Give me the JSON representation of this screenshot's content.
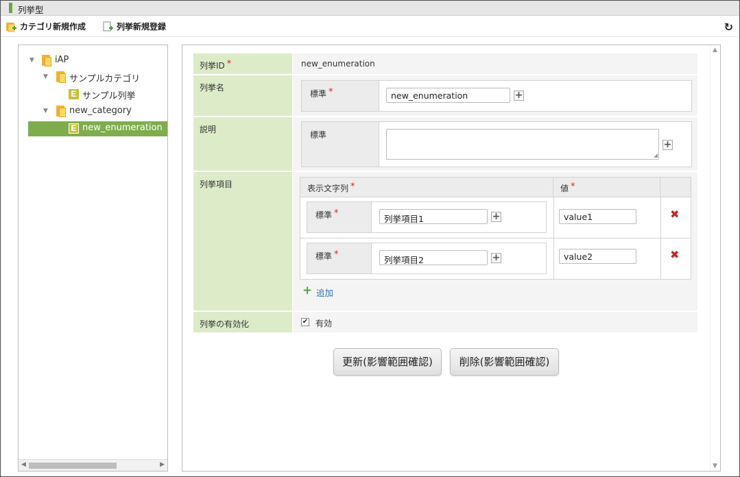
{
  "window": {
    "title": "列挙型"
  },
  "toolbar": {
    "create_category": "カテゴリ新規作成",
    "register_enumeration": "列挙新規登録",
    "refresh_icon": "refresh-icon"
  },
  "tree": {
    "root": "iAP",
    "items": [
      {
        "label": "サンプルカテゴリ",
        "type": "folder"
      },
      {
        "label": "サンプル列挙",
        "type": "enum",
        "badge": "E"
      },
      {
        "label": "new_category",
        "type": "folder"
      },
      {
        "label": "new_enumeration",
        "type": "enum",
        "badge": "E",
        "selected": true
      }
    ]
  },
  "form": {
    "enum_id": {
      "label": "列挙ID",
      "value": "new_enumeration"
    },
    "enum_name": {
      "label": "列挙名",
      "locale_label": "標準",
      "value": "new_enumeration"
    },
    "description": {
      "label": "説明",
      "locale_label": "標準",
      "value": ""
    },
    "items": {
      "label": "列挙項目",
      "col_display": "表示文字列",
      "col_value": "値",
      "rows": [
        {
          "locale_label": "標準",
          "display": "列挙項目1",
          "value": "value1"
        },
        {
          "locale_label": "標準",
          "display": "列挙項目2",
          "value": "value2"
        }
      ],
      "add_label": "追加"
    },
    "enable": {
      "label": "列挙の有効化",
      "checkbox_label": "有効",
      "checked": true
    }
  },
  "buttons": {
    "update": "更新(影響範囲確認)",
    "delete": "削除(影響範囲確認)"
  },
  "colors": {
    "accent": "#7fad4e",
    "label_bg": "#dcebc8",
    "required": "#dd2222"
  }
}
